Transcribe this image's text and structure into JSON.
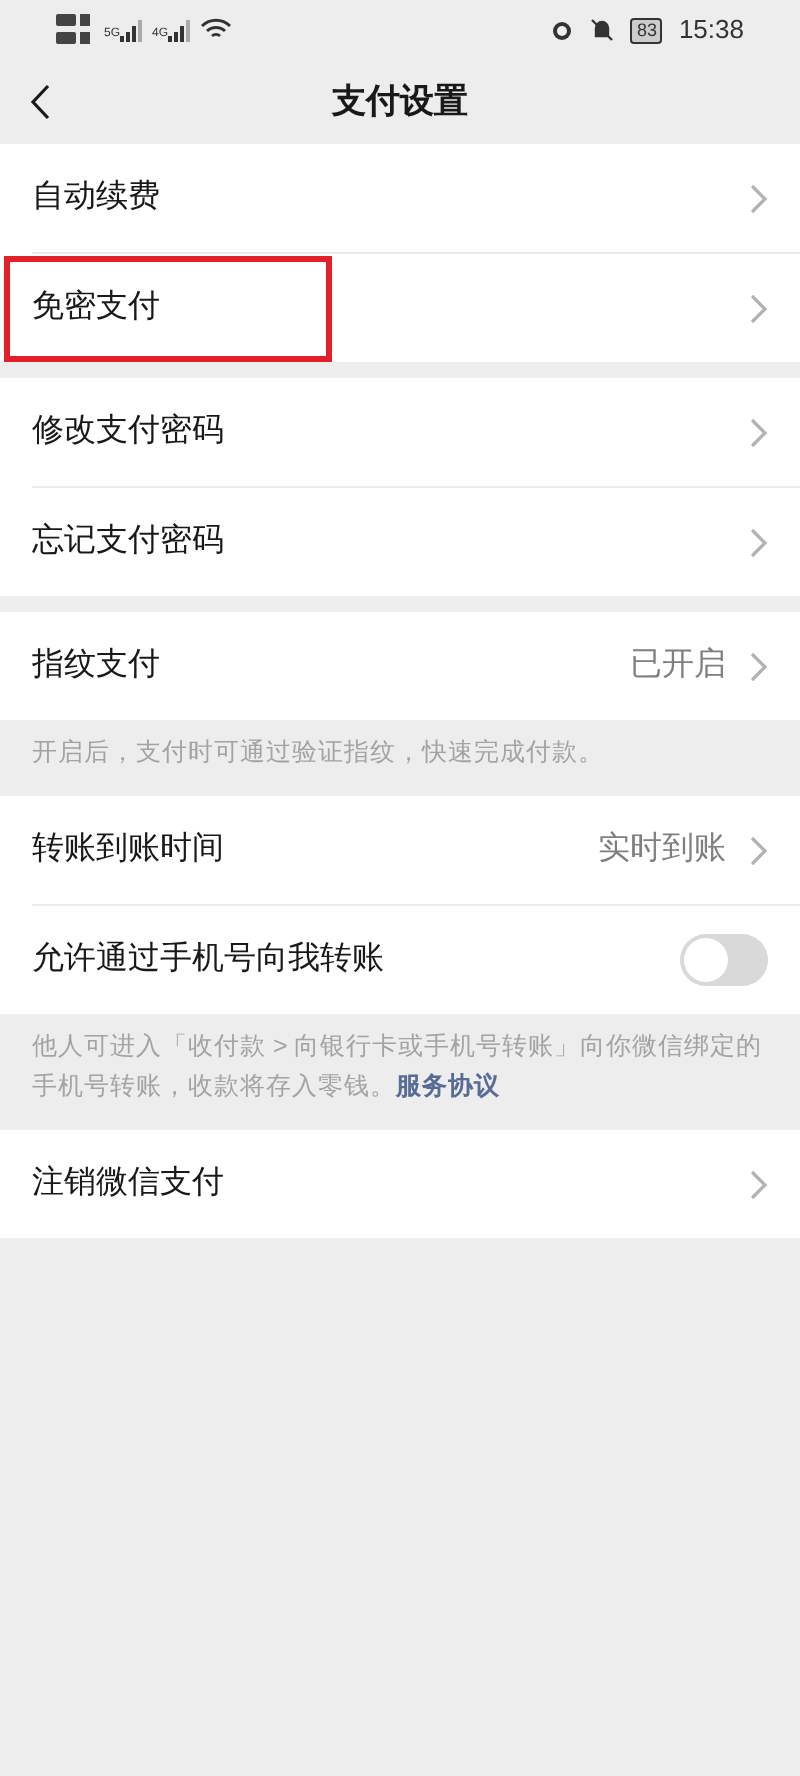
{
  "status_bar": {
    "network_labels": [
      "5G",
      "4G"
    ],
    "battery": "83",
    "time": "15:38"
  },
  "header": {
    "title": "支付设置"
  },
  "groups": [
    {
      "rows": [
        {
          "kind": "link",
          "label": "自动续费",
          "highlighted": false
        },
        {
          "kind": "link",
          "label": "免密支付",
          "highlighted": true
        }
      ]
    },
    {
      "rows": [
        {
          "kind": "link",
          "label": "修改支付密码",
          "highlighted": false
        },
        {
          "kind": "link",
          "label": "忘记支付密码",
          "highlighted": false
        }
      ]
    },
    {
      "rows": [
        {
          "kind": "link",
          "label": "指纹支付",
          "value": "已开启",
          "highlighted": false
        }
      ],
      "note": {
        "text": "开启后，支付时可通过验证指纹，快速完成付款。"
      }
    },
    {
      "rows": [
        {
          "kind": "link",
          "label": "转账到账时间",
          "value": "实时到账",
          "highlighted": false
        },
        {
          "kind": "toggle",
          "label": "允许通过手机号向我转账",
          "on": false,
          "highlighted": false
        }
      ],
      "note": {
        "text": "他人可进入「收付款 > 向银行卡或手机号转账」向你微信绑定的手机号转账，收款将存入零钱。",
        "link": "服务协议"
      }
    },
    {
      "rows": [
        {
          "kind": "link",
          "label": "注销微信支付",
          "highlighted": false
        }
      ]
    }
  ]
}
